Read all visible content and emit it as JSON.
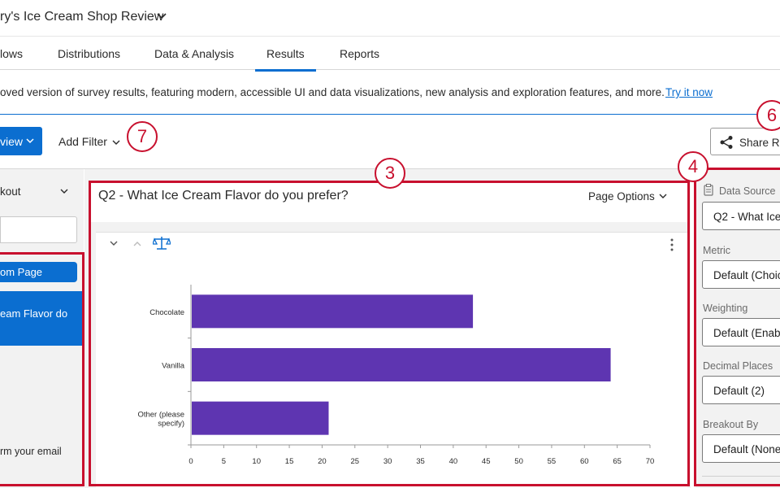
{
  "app": {
    "survey_title": "ry's Ice Cream Shop Review"
  },
  "nav": {
    "tabs": [
      {
        "label": "lows"
      },
      {
        "label": "Distributions"
      },
      {
        "label": "Data & Analysis"
      },
      {
        "label": "Results",
        "active": true
      },
      {
        "label": "Reports"
      }
    ]
  },
  "banner": {
    "message": "oved version of survey results, featuring modern, accessible UI and data visualizations, new analysis and exploration features, and more.",
    "link": "Try it now"
  },
  "toolbar": {
    "view_button": "view",
    "add_filter": "Add Filter",
    "share_button": "Share Re"
  },
  "sidebar": {
    "breakout_label": "kout",
    "search_placeholder": "",
    "page_pill": "om Page",
    "selected_item": "eam Flavor do",
    "email_item": "rm your email"
  },
  "question": {
    "title": "Q2 - What Ice Cream Flavor do you prefer?",
    "page_options": "Page Options"
  },
  "chart_data": {
    "type": "bar",
    "orientation": "horizontal",
    "categories": [
      "Chocolate",
      "Vanilla",
      "Other (please specify)"
    ],
    "values": [
      43,
      64,
      21
    ],
    "xlim": [
      0,
      70
    ],
    "xticks": [
      0,
      5,
      10,
      15,
      20,
      25,
      30,
      35,
      40,
      45,
      50,
      55,
      60,
      65,
      70
    ],
    "bar_color": "#5e35b1",
    "grid": false
  },
  "right_panel": {
    "data_source_label": "Data Source",
    "data_source_value": "Q2 - What Ice",
    "metric_label": "Metric",
    "metric_value": "Default (Choic",
    "weighting_label": "Weighting",
    "weighting_value": "Default (Enabl",
    "decimal_label": "Decimal Places",
    "decimal_value": "Default (2)",
    "breakout_label": "Breakout By",
    "breakout_value": "Default (None"
  },
  "callouts": {
    "n3": "3",
    "n4": "4",
    "n6": "6",
    "n7": "7"
  },
  "colors": {
    "accent": "#0b6ed0",
    "callout": "#c8102e",
    "bar": "#5e35b1"
  }
}
